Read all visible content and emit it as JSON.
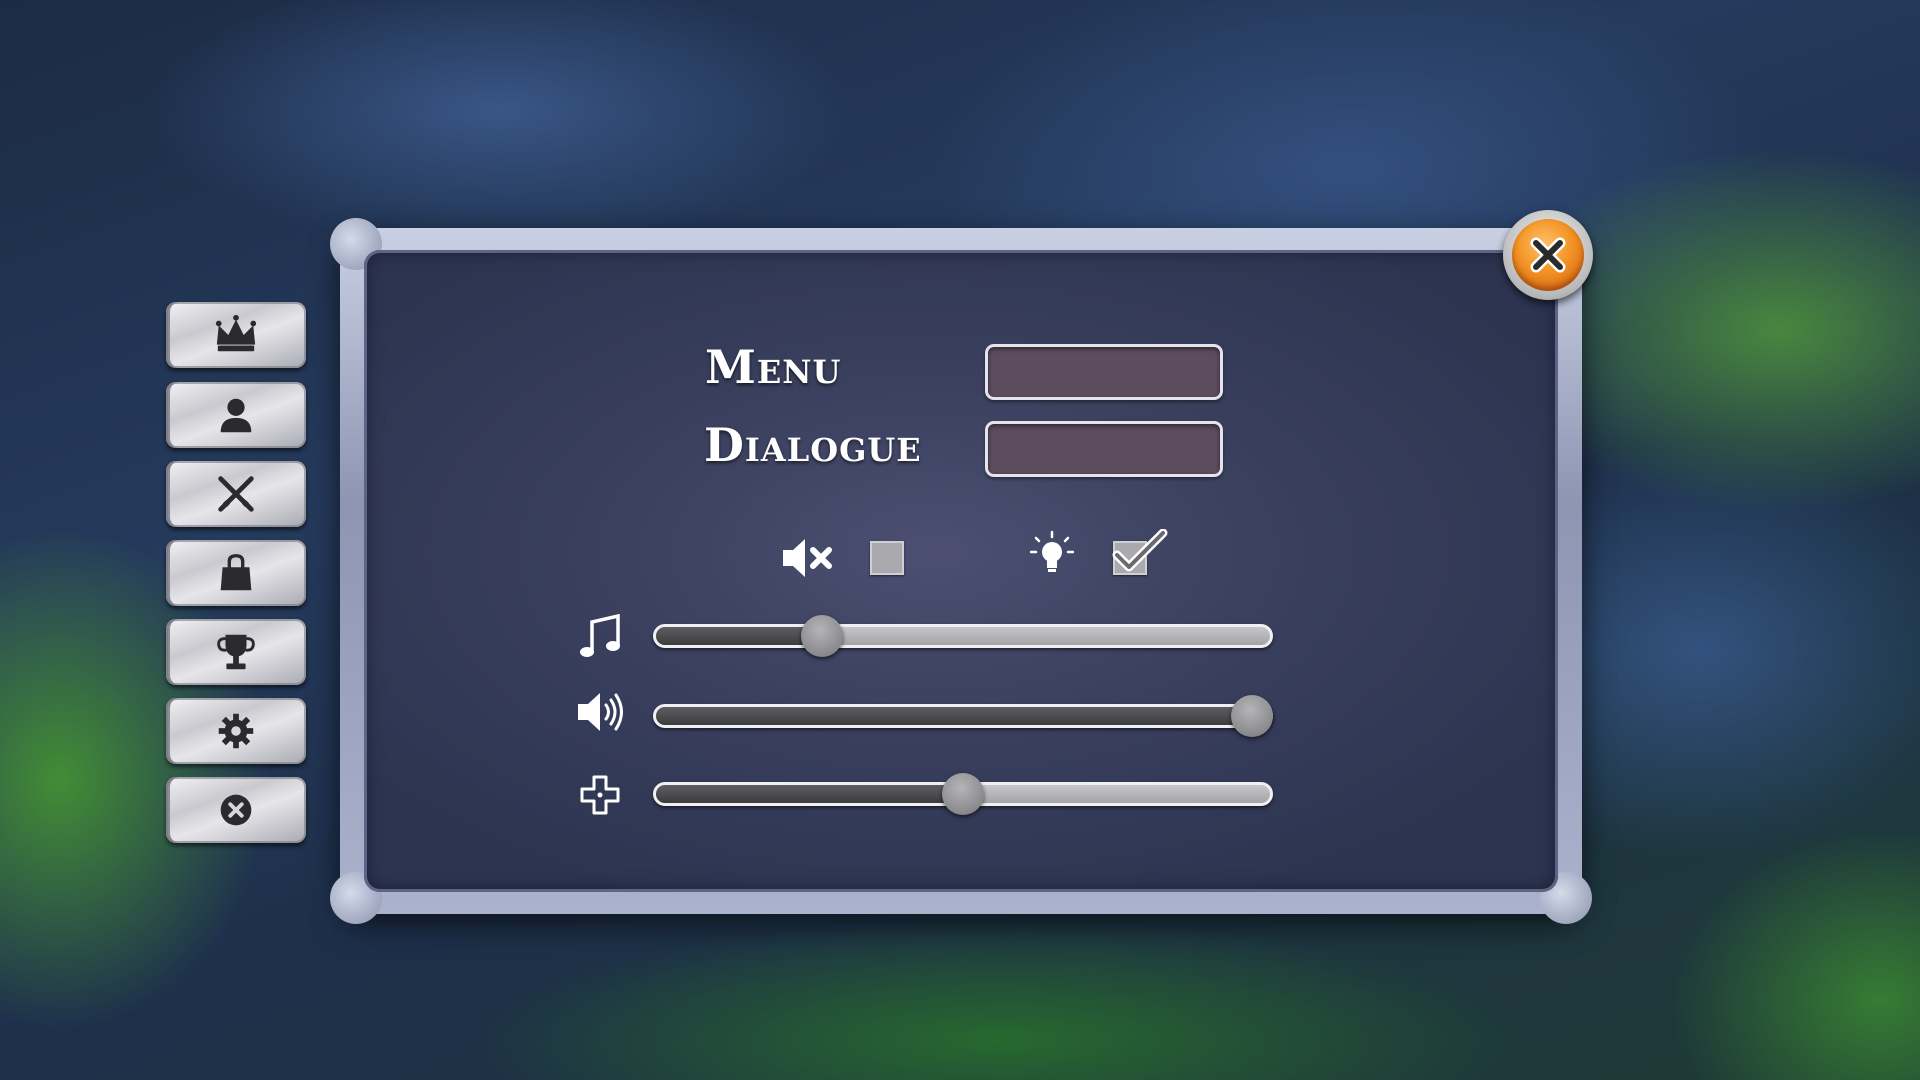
{
  "panel": {
    "labels": {
      "menu": "Menu",
      "dialogue": "Dialogue"
    },
    "inputs": {
      "menu_value": "",
      "dialogue_value": ""
    },
    "toggles": {
      "mute_checked": false,
      "hint_checked": true
    },
    "sliders": {
      "music_level": 0.27,
      "sound_level": 0.97,
      "controls_level": 0.5
    }
  },
  "sidebar": {
    "items": [
      {
        "icon": "crown-icon"
      },
      {
        "icon": "user-icon"
      },
      {
        "icon": "crossed-swords-icon"
      },
      {
        "icon": "shopping-bag-icon"
      },
      {
        "icon": "trophy-icon"
      },
      {
        "icon": "gear-icon"
      },
      {
        "icon": "close-circle-icon"
      }
    ]
  },
  "colors": {
    "close_button": "#f39324",
    "panel_background": "#3a405e",
    "textbox_fill": "#5c4d5e",
    "slider_fill": "#4a4a4c"
  }
}
